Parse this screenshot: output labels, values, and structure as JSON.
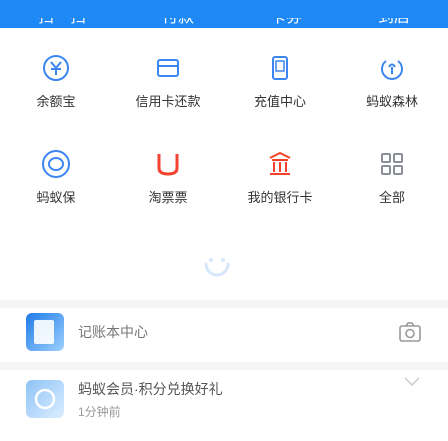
{
  "top_nav": {
    "items": [
      "扫一扫",
      "付款",
      "卡券",
      "到店"
    ]
  },
  "grid": {
    "row1": [
      {
        "icon": "yuebao-icon",
        "label": "余额宝",
        "color": "#3b86f0"
      },
      {
        "icon": "credit-card-icon",
        "label": "信用卡还款",
        "color": "#3b86f0"
      },
      {
        "icon": "phone-topup-icon",
        "label": "充值中心",
        "color": "#3b86f0"
      },
      {
        "icon": "ant-forest-icon",
        "label": "蚂蚁森林",
        "color": "#3b86f0"
      }
    ],
    "row2": [
      {
        "icon": "ant-insurance-icon",
        "label": "蚂蚁保",
        "color": "#3b86f0"
      },
      {
        "icon": "coupon-icon",
        "label": "淘票票",
        "color": "#f5422f"
      },
      {
        "icon": "bank-icon",
        "label": "我的银行卡",
        "color": "#f5422f"
      },
      {
        "icon": "all-apps-icon",
        "label": "全部",
        "color": "#8a8f99"
      }
    ]
  },
  "feed": {
    "card1": {
      "title": "记账本中心",
      "thumb_icon": "ledger-thumb-icon",
      "right_icon": "camera-icon"
    },
    "card2": {
      "title": "蚂蚁会员·积分兑换好礼",
      "subtitle": "1分钟前",
      "thumb_icon": "member-thumb-icon",
      "right_icon": "chevron-down-icon"
    }
  }
}
